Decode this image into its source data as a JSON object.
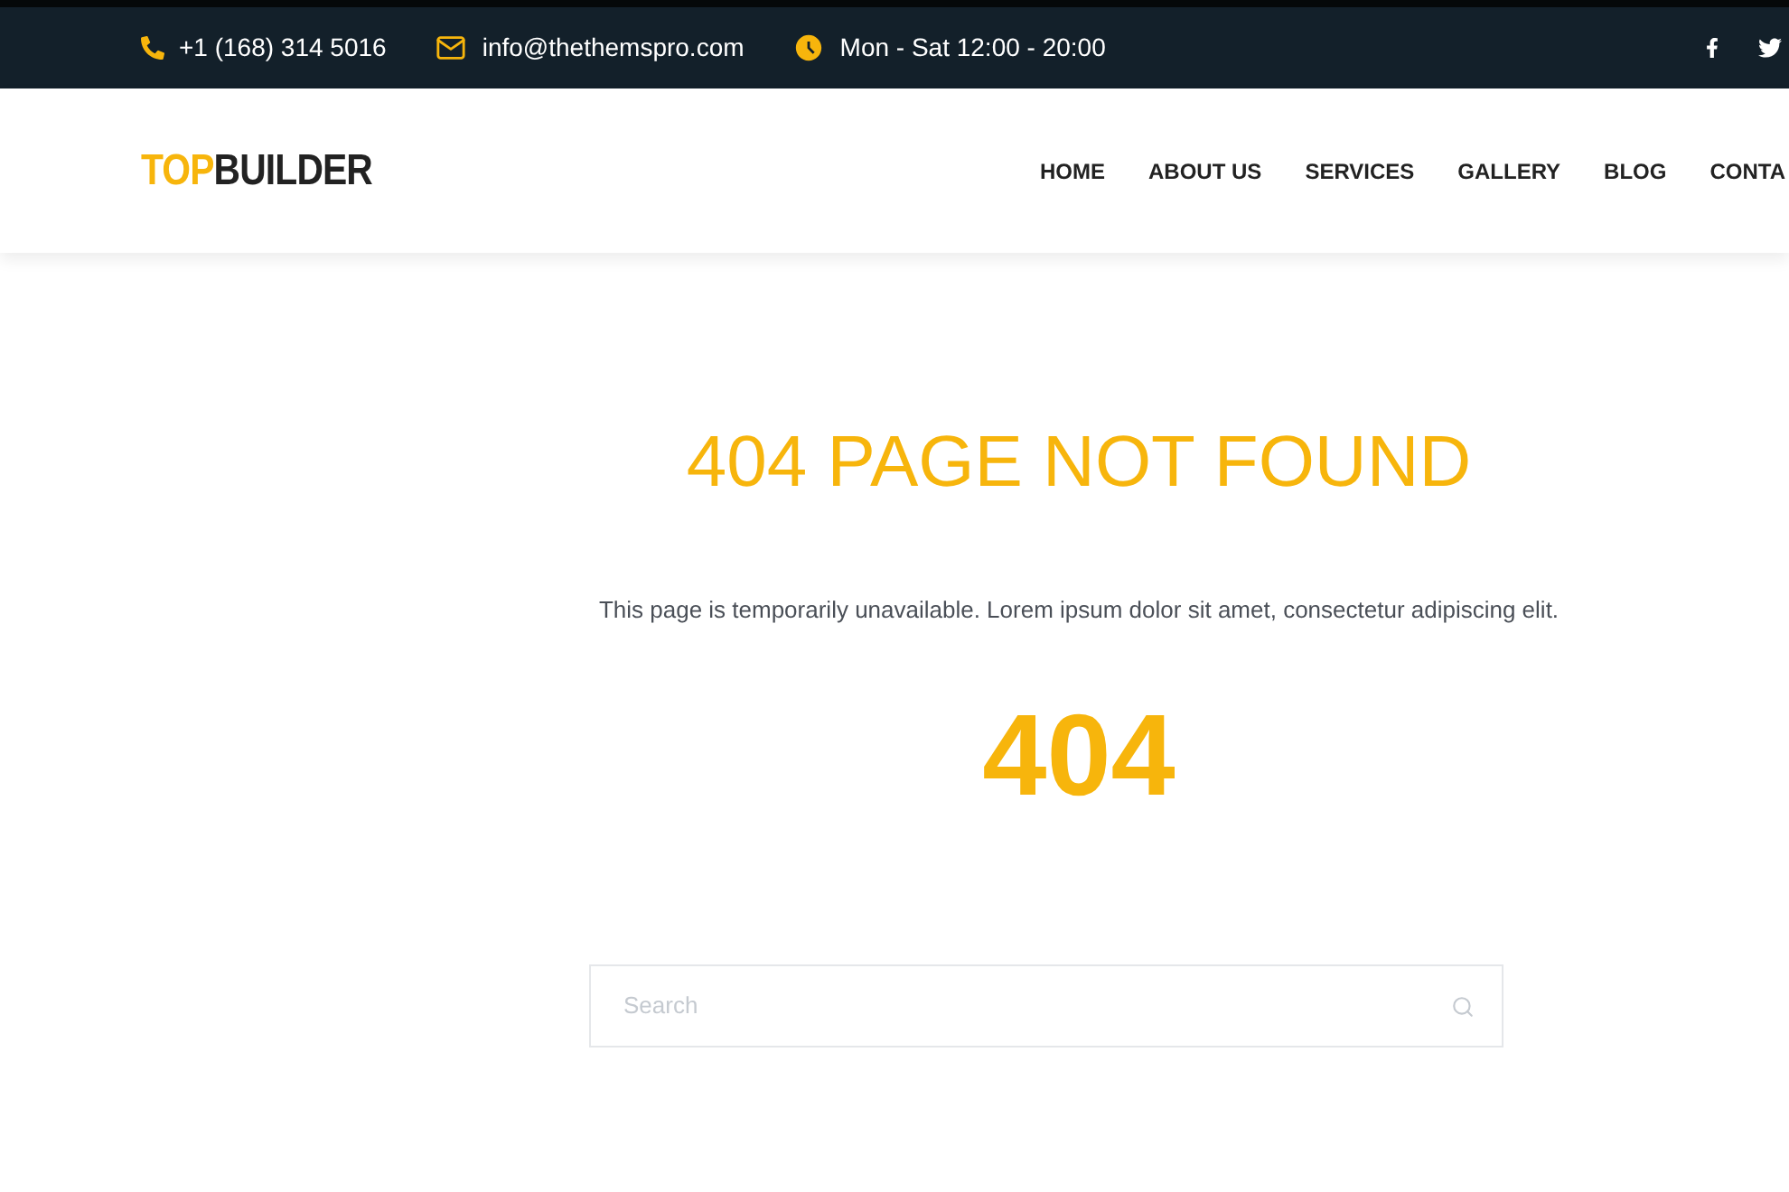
{
  "topbar": {
    "phone": "+1 (168) 314 5016",
    "email": "info@thethemspro.com",
    "hours": "Mon - Sat 12:00 - 20:00"
  },
  "logo": {
    "accent": "TOP",
    "rest": "BUILDER"
  },
  "nav": [
    {
      "label": "HOME"
    },
    {
      "label": "ABOUT US"
    },
    {
      "label": "SERVICES"
    },
    {
      "label": "GALLERY"
    },
    {
      "label": "BLOG"
    },
    {
      "label": "CONTA"
    }
  ],
  "error": {
    "title": "404 PAGE NOT FOUND",
    "message": "This page is temporarily unavailable. Lorem ipsum dolor sit amet, consectetur adipiscing elit.",
    "code": "404"
  },
  "search": {
    "placeholder": "Search"
  }
}
